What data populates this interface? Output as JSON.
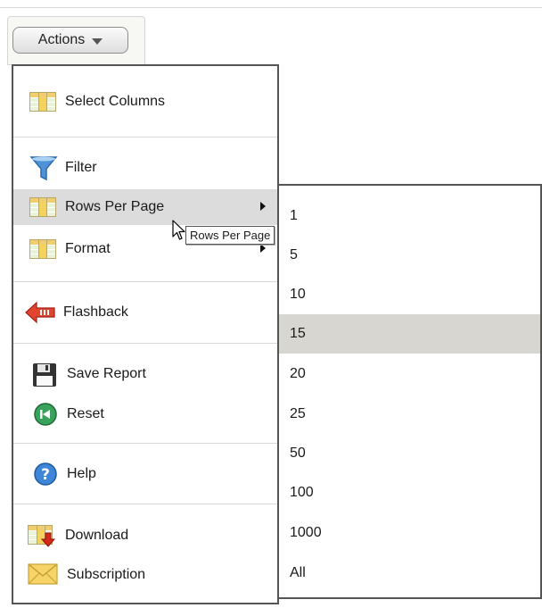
{
  "actions_button": {
    "label": "Actions"
  },
  "menu": {
    "items": [
      {
        "label": "Select Columns",
        "icon": "select-columns-icon"
      },
      {
        "label": "Filter",
        "icon": "filter-funnel-icon"
      },
      {
        "label": "Rows Per Page",
        "icon": "rows-per-page-icon",
        "has_submenu": true,
        "highlighted": true
      },
      {
        "label": "Format",
        "icon": "format-icon",
        "has_submenu": true
      },
      {
        "label": "Flashback",
        "icon": "flashback-arrow-icon"
      },
      {
        "label": "Save Report",
        "icon": "floppy-disk-icon"
      },
      {
        "label": "Reset",
        "icon": "reset-icon"
      },
      {
        "label": "Help",
        "icon": "help-icon"
      },
      {
        "label": "Download",
        "icon": "download-icon"
      },
      {
        "label": "Subscription",
        "icon": "envelope-icon"
      }
    ]
  },
  "rows_per_page_submenu": {
    "options": [
      "1",
      "5",
      "10",
      "15",
      "20",
      "25",
      "50",
      "100",
      "1000",
      "All"
    ],
    "highlighted": "15"
  },
  "tooltip": {
    "text": "Rows Per Page"
  },
  "colors": {
    "highlight": "#dcdcdc",
    "submenu_highlight": "#d8d6d0",
    "menu_border": "#555555"
  }
}
